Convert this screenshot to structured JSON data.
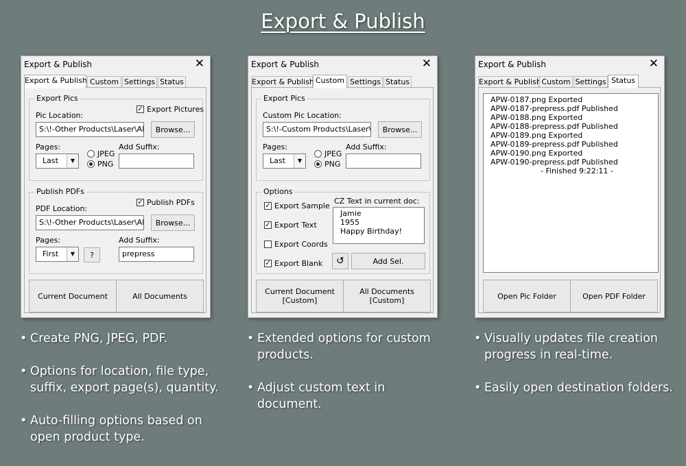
{
  "page_title": "Export & Publish",
  "dialogs": {
    "d1": {
      "title": "Export & Publish",
      "tabs": [
        "Export & Publish",
        "Custom",
        "Settings",
        "Status"
      ],
      "export_pics": {
        "group": "Export Pics",
        "location_label": "Pic Location:",
        "location_value": "S:\\!-Other Products\\Laser\\APW",
        "checkbox_label": "Export Pictures",
        "browse": "Browse...",
        "pages_label": "Pages:",
        "pages_value": "Last",
        "radio_jpeg": "JPEG",
        "radio_png": "PNG",
        "suffix_label": "Add Suffix:",
        "suffix_value": ""
      },
      "publish_pdfs": {
        "group": "Publish PDFs",
        "location_label": "PDF Location:",
        "location_value": "S:\\!-Other Products\\Laser\\APW",
        "checkbox_label": "Publish PDFs",
        "browse": "Browse...",
        "pages_label": "Pages:",
        "pages_value": "First",
        "help": "?",
        "suffix_label": "Add Suffix:",
        "suffix_value": "prepress"
      },
      "buttons": [
        "Current Document",
        "All Documents"
      ]
    },
    "d2": {
      "title": "Export & Publish",
      "tabs": [
        "Export & Publish",
        "Custom",
        "Settings",
        "Status"
      ],
      "export_pics": {
        "group": "Export Pics",
        "location_label": "Custom Pic Location:",
        "location_value": "S:\\!-Custom Products\\Laser\\A",
        "browse": "Browse...",
        "pages_label": "Pages:",
        "pages_value": "Last",
        "radio_jpeg": "JPEG",
        "radio_png": "PNG",
        "suffix_label": "Add Suffix:",
        "suffix_value": ""
      },
      "options": {
        "group": "Options",
        "checks": [
          "Export Sample",
          "Export Text",
          "Export Coords",
          "Export Blank"
        ],
        "cz_label": "CZ Text in current doc:",
        "cz_lines": [
          "Jamie",
          "1955",
          "Happy Birthday!"
        ],
        "refresh_icon": "↺",
        "add_sel": "Add Sel."
      },
      "buttons": [
        {
          "l1": "Current Document",
          "l2": "[Custom]"
        },
        {
          "l1": "All Documents",
          "l2": "[Custom]"
        }
      ]
    },
    "d3": {
      "title": "Export & Publish",
      "tabs": [
        "Export & Publish",
        "Custom",
        "Settings",
        "Status"
      ],
      "status_lines": [
        "APW-0187.png Exported",
        "APW-0187-prepress.pdf Published",
        "APW-0188.png Exported",
        "APW-0188-prepress.pdf Published",
        "APW-0189.png Exported",
        "APW-0189-prepress.pdf Published",
        "APW-0190.png Exported",
        "APW-0190-prepress.pdf Published"
      ],
      "finished": "- Finished 9:22:11 -",
      "buttons": [
        "Open Pic Folder",
        "Open PDF Folder"
      ]
    }
  },
  "bullets": {
    "col1": [
      "Create PNG, JPEG, PDF.",
      "Options for location, file type, suffix, export page(s), quantity.",
      "Auto-filling options based on open product type."
    ],
    "col2": [
      "Extended options for custom products.",
      "Adjust custom text in document."
    ],
    "col3": [
      "Visually updates file creation progress in real-time.",
      "Easily open destination folders."
    ]
  }
}
